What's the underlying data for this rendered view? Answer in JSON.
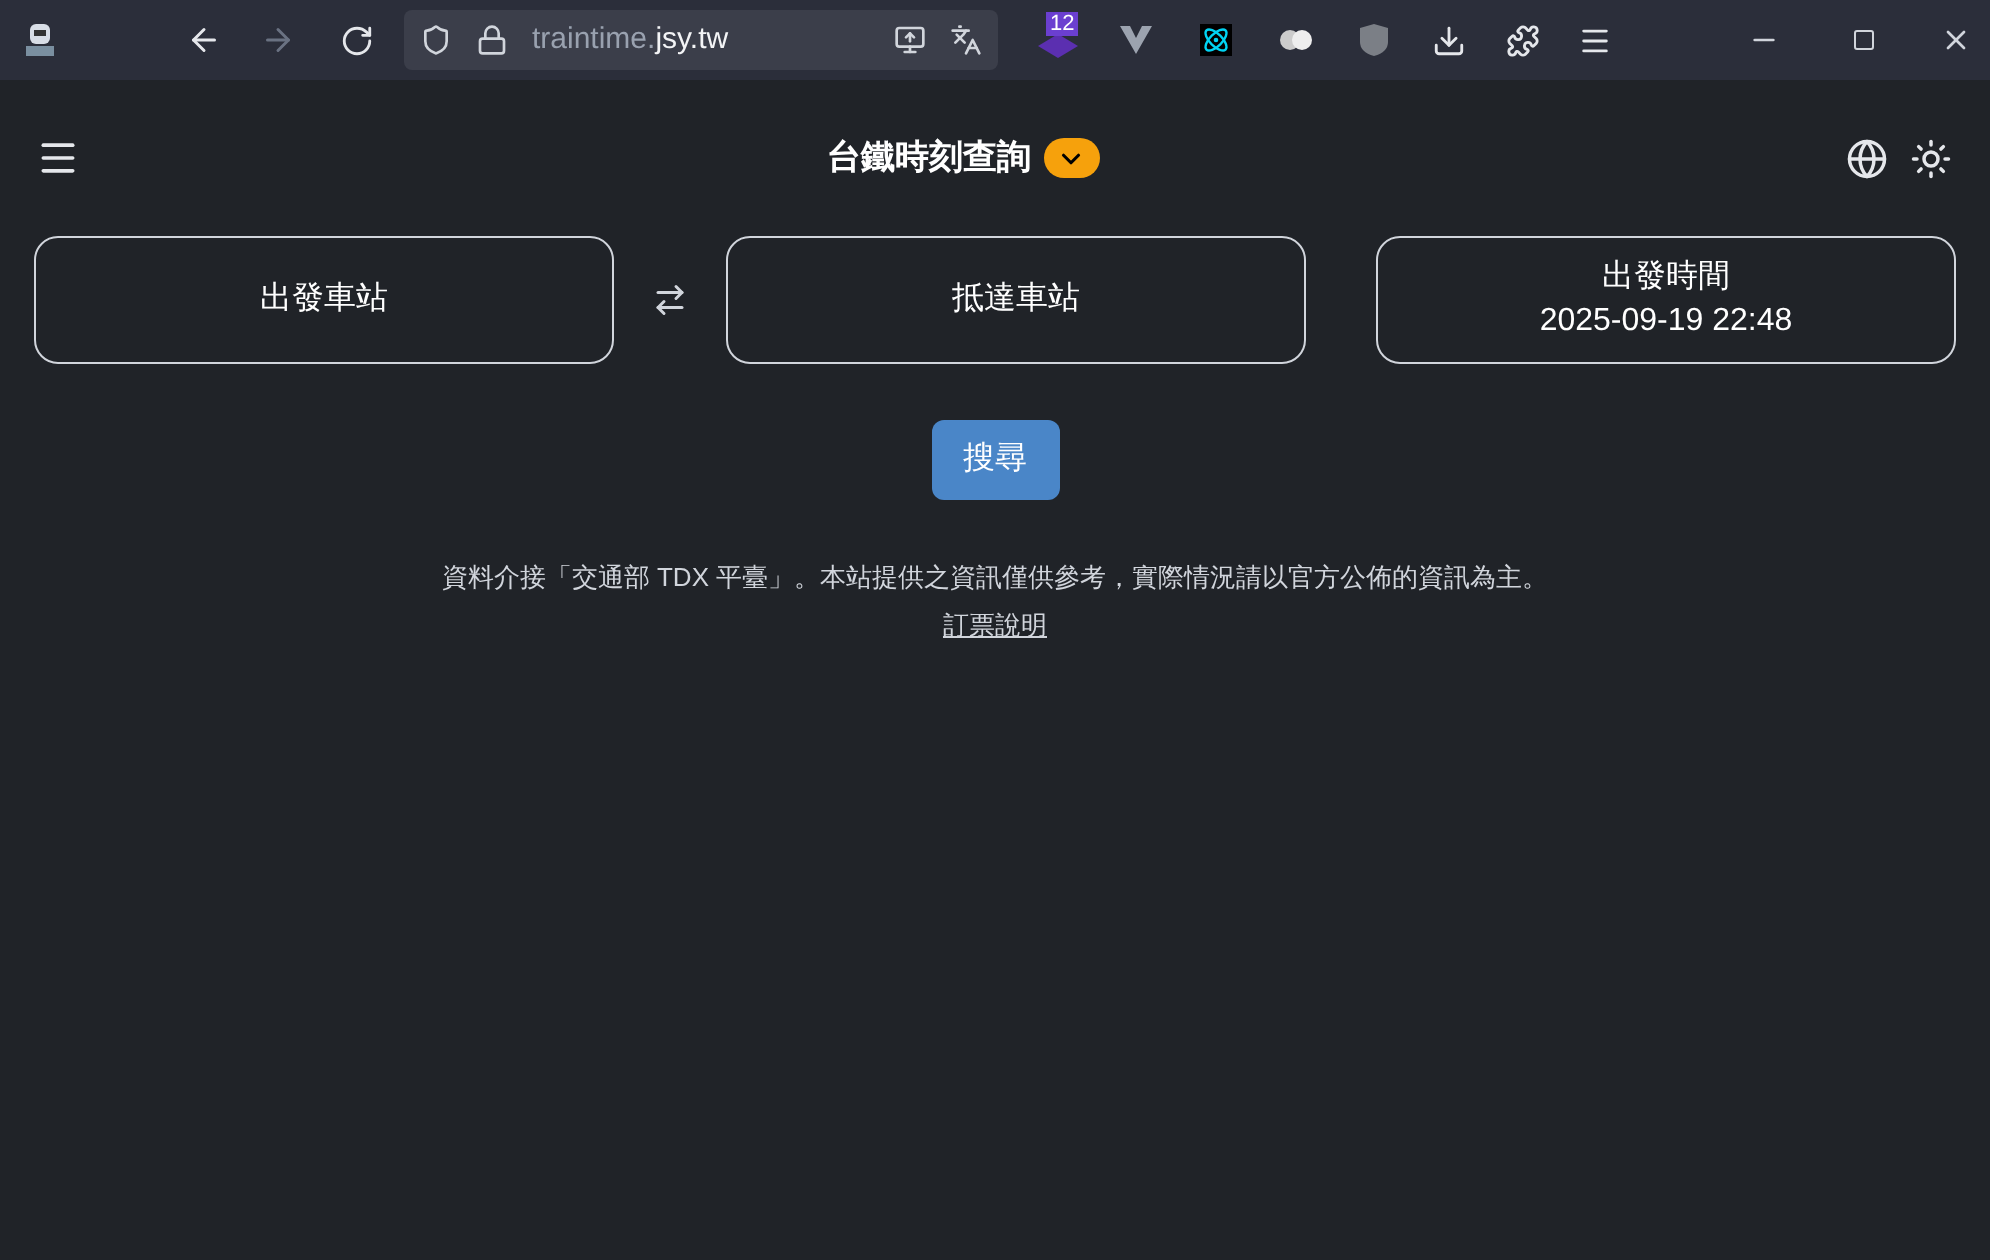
{
  "browser": {
    "url": {
      "host": "traintime.",
      "domain": "jsy.tw"
    },
    "extension_badge": "12",
    "back_disabled": false,
    "forward_disabled": true
  },
  "header": {
    "title": "台鐵時刻查詢"
  },
  "fields": [
    {
      "kind": "station",
      "label": "出發車站"
    },
    {
      "kind": "swap"
    },
    {
      "kind": "station",
      "label": "抵達車站"
    },
    {
      "kind": "time",
      "label": "出發時間",
      "value": "2025-09-19 22:48"
    }
  ],
  "search_button": "搜尋",
  "notice": "資料介接「交通部 TDX 平臺」。本站提供之資訊僅供參考，實際情況請以官方公佈的資訊為主。",
  "link": "訂票說明"
}
